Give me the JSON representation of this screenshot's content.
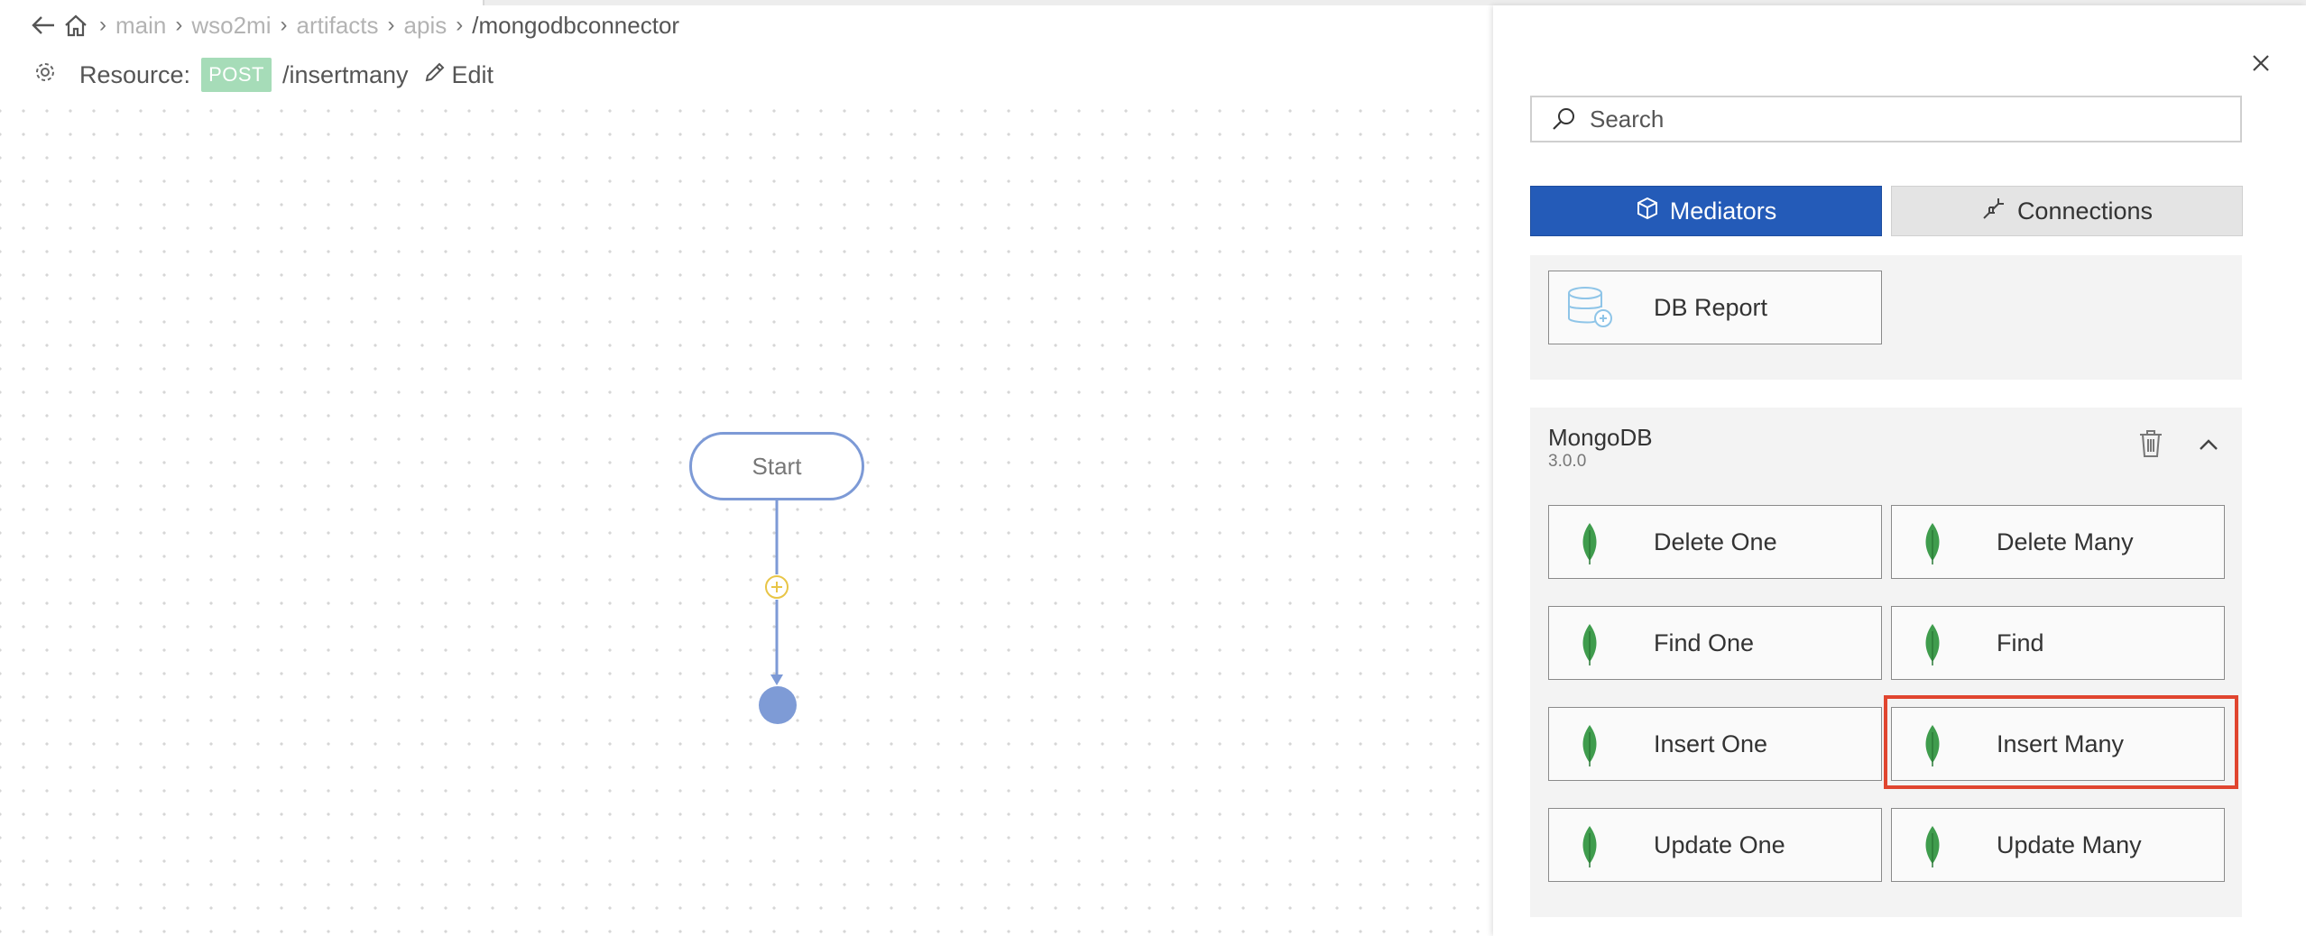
{
  "breadcrumb": {
    "items": [
      "main",
      "wso2mi",
      "artifacts",
      "apis"
    ],
    "current": "/mongodbconnector"
  },
  "resource": {
    "label": "Resource:",
    "method": "POST",
    "path": "/insertmany",
    "edit_label": "Edit"
  },
  "diagram": {
    "start_label": "Start"
  },
  "panel": {
    "search_placeholder": "Search",
    "tabs": {
      "mediators": "Mediators",
      "connections": "Connections"
    },
    "db_report_label": "DB Report",
    "connector": {
      "name": "MongoDB",
      "version": "3.0.0",
      "operations": [
        "Delete One",
        "Delete Many",
        "Find One",
        "Find",
        "Insert One",
        "Insert Many",
        "Update One",
        "Update Many"
      ]
    }
  },
  "colors": {
    "primary": "#245bb8",
    "post_badge": "#a6dcb8",
    "flow_line": "#7d9ad6",
    "add_icon": "#e8c547",
    "highlight": "#e0452f",
    "leaf": "#3f9c4d"
  },
  "icons": [
    "back-arrow-icon",
    "home-icon",
    "gear-icon",
    "pencil-icon",
    "close-icon",
    "search-icon",
    "mediator-icon",
    "connection-icon",
    "database-icon",
    "trash-icon",
    "chevron-up-icon",
    "mongodb-leaf-icon",
    "plus-circle-icon"
  ]
}
